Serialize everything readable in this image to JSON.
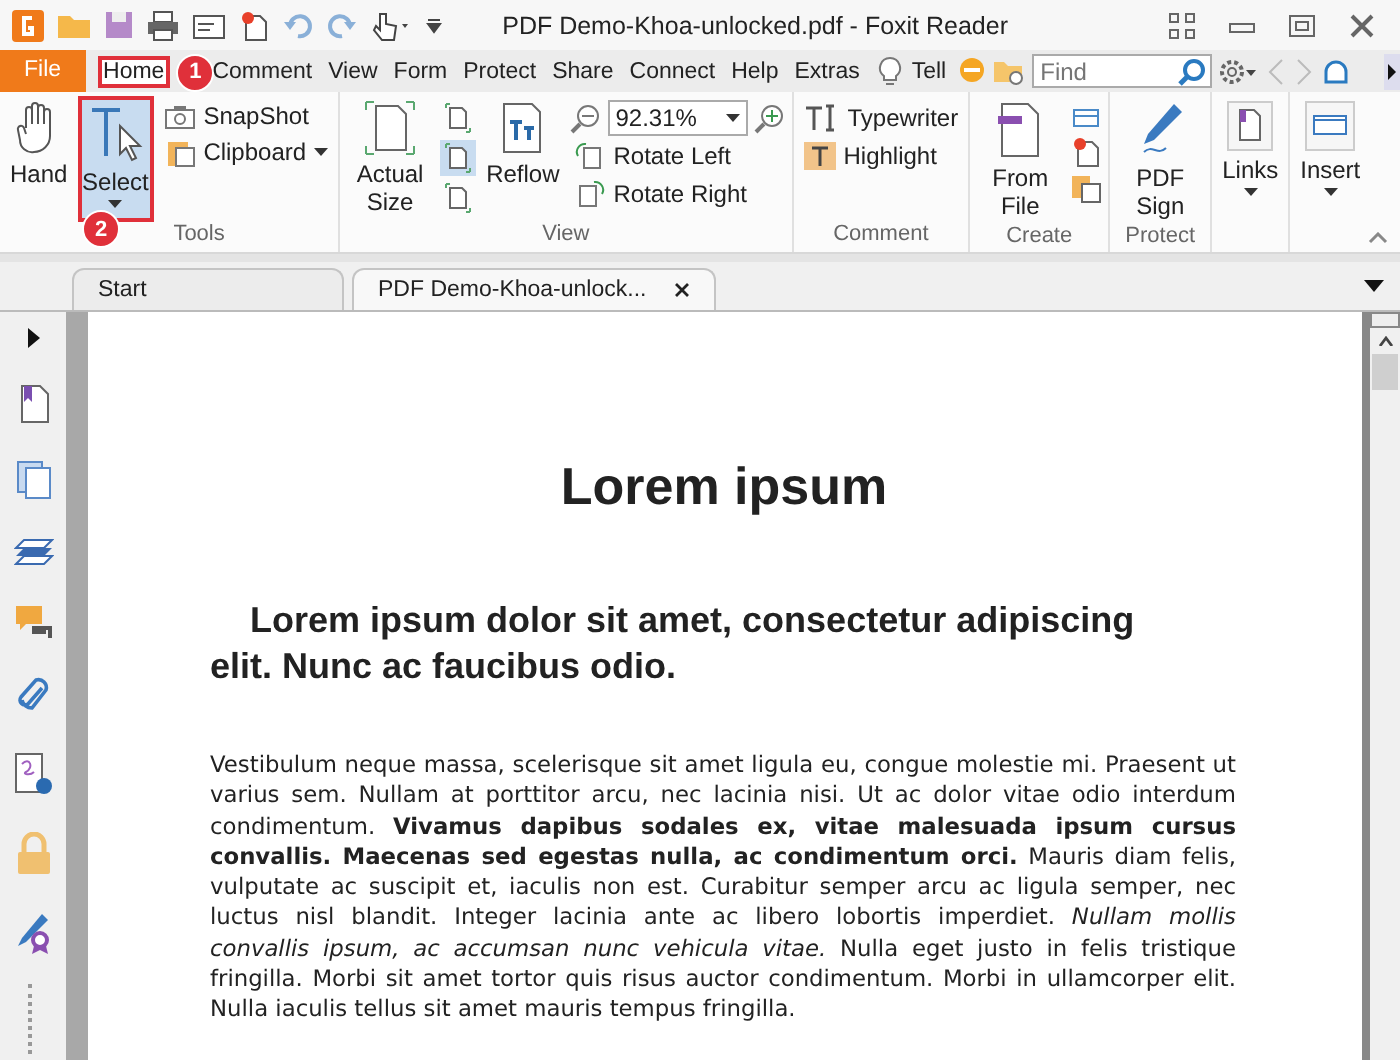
{
  "window": {
    "title": "PDF Demo-Khoa-unlocked.pdf - Foxit Reader"
  },
  "file_button": "File",
  "menu": [
    {
      "label": "Home",
      "kind": "tab",
      "selected": true,
      "annotated": true
    },
    {
      "label": "Comment",
      "kind": "tab",
      "selected": false,
      "annotated": false
    },
    {
      "label": "View",
      "kind": "tab",
      "selected": false,
      "annotated": false
    },
    {
      "label": "Form",
      "kind": "tab",
      "selected": false,
      "annotated": false
    },
    {
      "label": "Protect",
      "kind": "tab",
      "selected": false,
      "annotated": false
    },
    {
      "label": "Share",
      "kind": "tab",
      "selected": false,
      "annotated": false
    },
    {
      "label": "Connect",
      "kind": "tab",
      "selected": false,
      "annotated": false
    },
    {
      "label": "Help",
      "kind": "tab",
      "selected": false,
      "annotated": false
    },
    {
      "label": "Extras",
      "kind": "tab",
      "selected": false,
      "annotated": false
    }
  ],
  "tell": "Tell",
  "search": {
    "placeholder": "Find"
  },
  "ribbon": {
    "tools": {
      "label": "Tools",
      "hand": "Hand",
      "select": {
        "label": "Select",
        "selected": true,
        "annotated": true
      },
      "snapshot": "SnapShot",
      "clipboard": "Clipboard"
    },
    "view": {
      "label": "View",
      "actual_size": "Actual Size",
      "fit_modes": [
        {
          "selected": false
        },
        {
          "selected": true
        },
        {
          "selected": false
        }
      ],
      "reflow": "Reflow",
      "zoom": "92.31%",
      "rotate_left": "Rotate Left",
      "rotate_right": "Rotate Right"
    },
    "comment": {
      "label": "Comment",
      "typewriter": "Typewriter",
      "highlight": "Highlight"
    },
    "create": {
      "label": "Create",
      "from_file": "From File"
    },
    "protect": {
      "label": "Protect",
      "pdf_sign": "PDF Sign"
    },
    "links": "Links",
    "insert": "Insert"
  },
  "callouts": [
    {
      "number": "1"
    },
    {
      "number": "2"
    }
  ],
  "doc_tabs": [
    {
      "label": "Start",
      "selected": false,
      "closable": false
    },
    {
      "label": "PDF Demo-Khoa-unlock...",
      "selected": true,
      "closable": true
    }
  ],
  "page": {
    "title": "Lorem ipsum",
    "heading": "Lorem ipsum dolor sit amet, consectetur adipiscing elit. Nunc ac faucibus odio.",
    "paragraph": "Vestibulum neque massa, scelerisque sit amet ligula eu, congue molestie mi. Praesent ut varius sem. Nullam at porttitor arcu, nec lacinia nisi. Ut ac dolor vitae odio interdum condimentum. **Vivamus dapibus sodales ex, vitae malesuada ipsum cursus convallis. Maecenas sed egestas nulla, ac condimentum orci.** Mauris diam felis, vulputate ac suscipit et, iaculis non est. Curabitur semper arcu ac ligula semper, nec luctus nisl blandit. Integer lacinia ante ac libero lobortis imperdiet. *Nullam mollis convallis ipsum, ac accumsan nunc vehicula vitae.* Nulla eget justo in felis tristique fringilla. Morbi sit amet tortor quis risus auctor condimentum. Morbi in ullamcorper elit. Nulla iaculis tellus sit amet mauris tempus fringilla."
  }
}
